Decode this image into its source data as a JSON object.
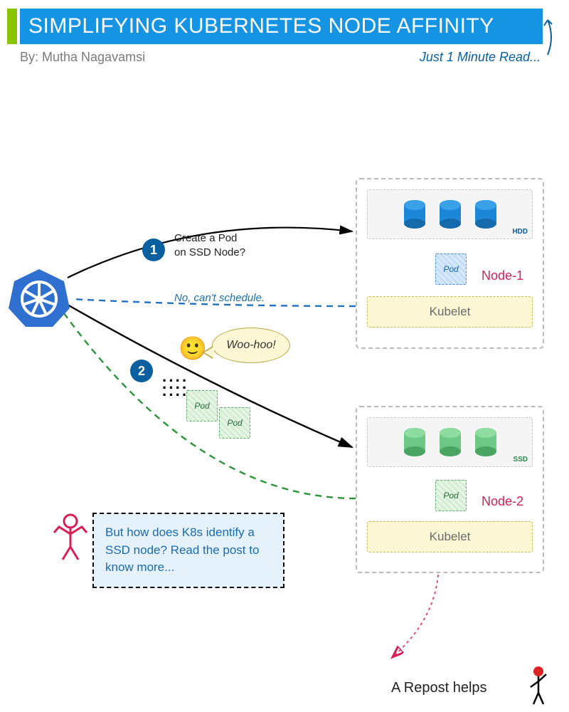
{
  "header": {
    "title": "SIMPLIFYING KUBERNETES NODE AFFINITY",
    "byline": "By: Mutha Nagavamsi",
    "readtime": "Just 1 Minute Read..."
  },
  "icons": {
    "k8s": "kubernetes-wheel"
  },
  "steps": {
    "one": {
      "num": "1",
      "label": "Create a Pod\non SSD Node?"
    },
    "two": {
      "num": "2"
    }
  },
  "response_no": "No, can't schedule.",
  "woohoo": "Woo-hoo!",
  "pod_label": "Pod",
  "nodes": {
    "n1": {
      "name": "Node-1",
      "disk_type": "HDD",
      "kubelet": "Kubelet"
    },
    "n2": {
      "name": "Node-2",
      "disk_type": "SSD",
      "kubelet": "Kubelet"
    }
  },
  "question": "But how does K8s identify a SSD node? Read the post to know more...",
  "footer": {
    "repost": "A Repost helps"
  },
  "colors": {
    "title_bg": "#1594e4",
    "accent_green": "#8bc400",
    "badge": "#0a5f9e",
    "node_name": "#d81e55"
  }
}
